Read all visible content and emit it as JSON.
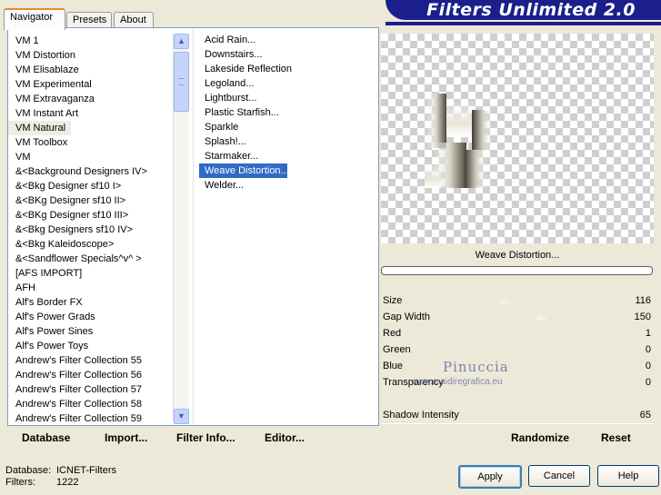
{
  "title": "Filters Unlimited 2.0",
  "tabs": [
    "Navigator",
    "Presets",
    "About"
  ],
  "categories": [
    "VM 1",
    "VM Distortion",
    "VM Elisablaze",
    "VM Experimental",
    "VM Extravaganza",
    "VM Instant Art",
    "VM Natural",
    "VM Toolbox",
    "VM",
    "&<Background Designers IV>",
    "&<Bkg Designer sf10 I>",
    "&<BKg Designer sf10 II>",
    "&<BKg Designer sf10 III>",
    "&<Bkg Designers sf10 IV>",
    "&<Bkg Kaleidoscope>",
    "&<Sandflower Specials^v^ >",
    "[AFS IMPORT]",
    "AFH",
    "Alf's Border FX",
    "Alf's Power Grads",
    "Alf's Power Sines",
    "Alf's Power Toys",
    "Andrew's Filter Collection 55",
    "Andrew's Filter Collection 56",
    "Andrew's Filter Collection 57",
    "Andrew's Filter Collection 58",
    "Andrew's Filter Collection 59"
  ],
  "selected_category": "VM Natural",
  "filters": [
    "Acid Rain...",
    "Downstairs...",
    "Lakeside Reflection",
    "Legoland...",
    "Lightburst...",
    "Plastic Starfish...",
    "Sparkle",
    "Splash!...",
    "Starmaker...",
    "Weave Distortion...",
    "Welder..."
  ],
  "selected_filter": "Weave Distortion...",
  "left_buttons": {
    "database": "Database",
    "import": "Import...",
    "filter_info": "Filter Info...",
    "editor": "Editor..."
  },
  "preview_name": "Weave Distortion...",
  "params": [
    {
      "label": "Size",
      "value": "116"
    },
    {
      "label": "Gap Width",
      "value": "150"
    },
    {
      "label": "Red",
      "value": "1"
    },
    {
      "label": "Green",
      "value": "0"
    },
    {
      "label": "Blue",
      "value": "0"
    },
    {
      "label": "Transparency",
      "value": "0"
    },
    {
      "label": "",
      "value": ""
    },
    {
      "label": "Shadow Intensity",
      "value": "65"
    }
  ],
  "right_buttons": {
    "randomize": "Randomize",
    "reset": "Reset"
  },
  "watermark": {
    "line1": "Pinuccia",
    "line2": "www.maidiregrafica.eu"
  },
  "footer": {
    "database_label": "Database:",
    "database_value": "ICNET-Filters",
    "filters_label": "Filters:",
    "filters_value": "1222"
  },
  "dialog_buttons": {
    "apply": "Apply",
    "cancel": "Cancel",
    "help": "Help"
  },
  "colors": {
    "banner": "#1a1f8c",
    "selection": "#316ac5",
    "tab_accent": "#e68b2c"
  }
}
